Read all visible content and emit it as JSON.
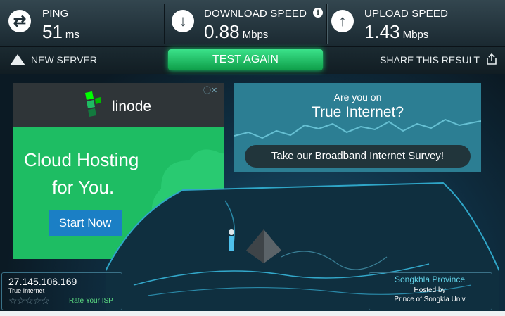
{
  "stats": {
    "ping": {
      "label": "PING",
      "value": "51",
      "unit": "ms"
    },
    "download": {
      "label": "DOWNLOAD SPEED",
      "value": "0.88",
      "unit": "Mbps"
    },
    "upload": {
      "label": "UPLOAD SPEED",
      "value": "1.43",
      "unit": "Mbps"
    }
  },
  "toolbar": {
    "new_server": "NEW SERVER",
    "test_again": "TEST AGAIN",
    "share": "SHARE THIS RESULT"
  },
  "ad": {
    "brand": "linode",
    "headline_1": "Cloud Hosting",
    "headline_2": "for You.",
    "cta": "Start Now"
  },
  "survey": {
    "question": "Are you on",
    "isp": "True Internet?",
    "cta": "Take our Broadband Internet Survey!"
  },
  "client": {
    "ip": "27.145.106.169",
    "isp": "True Internet",
    "rate_label": "Rate Your ISP",
    "stars": 0
  },
  "server": {
    "province": "Songkhla Province",
    "hosted_by_label": "Hosted by",
    "host": "Prince of Songkla Univ"
  },
  "colors": {
    "accent_green": "#1ebd63",
    "button_blue": "#1b7fc5",
    "survey_teal": "#2c7e93",
    "province_cyan": "#61d1e6"
  }
}
